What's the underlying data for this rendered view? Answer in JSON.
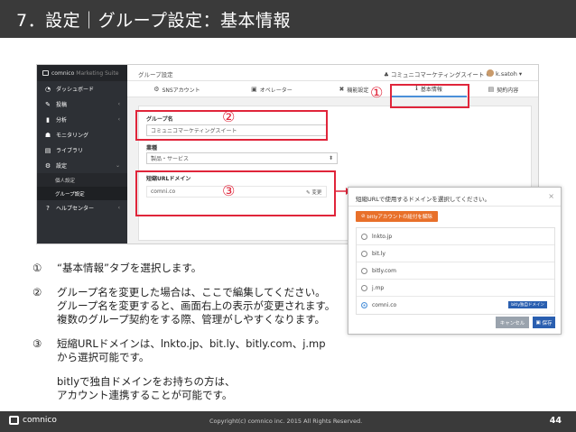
{
  "slide": {
    "title": "7．設定｜グループ設定：基本情報",
    "page_number": "44",
    "copyright": "Copyright(c) comnico inc. 2015 All Rights Reserved.",
    "footer_logo": "comnico"
  },
  "app": {
    "brand": "comnico",
    "brand_suite": "Marketing Suite",
    "nav": [
      {
        "icon": "dashboard-icon",
        "glyph": "◔",
        "label": "ダッシュボード"
      },
      {
        "icon": "pencil-icon",
        "glyph": "✎",
        "label": "投稿",
        "chevron": "‹"
      },
      {
        "icon": "chart-icon",
        "glyph": "▮",
        "label": "分析",
        "chevron": "‹"
      },
      {
        "icon": "chat-icon",
        "glyph": "☗",
        "label": "モニタリング"
      },
      {
        "icon": "book-icon",
        "glyph": "▤",
        "label": "ライブラリ"
      },
      {
        "icon": "gear-icon",
        "glyph": "⚙",
        "label": "設定",
        "chevron": "⌄"
      }
    ],
    "nav_sub": [
      "個人設定",
      "グループ設定"
    ],
    "nav_help": {
      "icon": "question-icon",
      "glyph": "?",
      "label": "ヘルプセンター",
      "chevron": "‹"
    },
    "page_title": "グループ設定",
    "group_selector": "コミュニコマーケティングスイート",
    "user_name": "k.satoh",
    "tabs": [
      {
        "icon": "sns-icon",
        "glyph": "⚙",
        "label": "SNSアカウント"
      },
      {
        "icon": "person-card-icon",
        "glyph": "▣",
        "label": "オペレーター"
      },
      {
        "icon": "wrench-icon",
        "glyph": "✖",
        "label": "機能設定"
      },
      {
        "icon": "info-icon",
        "glyph": "ℹ",
        "label": "基本情報"
      },
      {
        "icon": "contract-icon",
        "glyph": "▤",
        "label": "契約内容"
      }
    ],
    "fields": {
      "group_name_label": "グループ名",
      "group_name_value": "コミュニコマーケティングスイート",
      "industry_label": "業種",
      "industry_value": "製品・サービス",
      "domain_label": "短縮URLドメイン",
      "domain_value": "comni.co",
      "edit_label": "✎ 変更"
    }
  },
  "popup": {
    "header": "短縮URLで使用するドメインを選択してください。",
    "close": "×",
    "bitly_button": "bitlyアカウントの紐付を解除",
    "options": [
      {
        "label": "lnkto.jp",
        "selected": false
      },
      {
        "label": "bit.ly",
        "selected": false
      },
      {
        "label": "bitly.com",
        "selected": false
      },
      {
        "label": "j.mp",
        "selected": false
      },
      {
        "label": "comni.co",
        "selected": true,
        "badge": "bitly独自ドメイン"
      }
    ],
    "cancel": "キャンセル",
    "save": "保存"
  },
  "markers": [
    "①",
    "②",
    "③"
  ],
  "explanation": {
    "item1_mark": "①",
    "item1_text": "“基本情報”タブを選択します。",
    "item2_mark": "②",
    "item2_line1": "グループ名を変更した場合は、ここで編集してください。",
    "item2_line2": "グループ名を変更すると、画面右上の表示が変更されます。",
    "item2_line3": "複数のグループ契約をする際、管理がしやすくなります。",
    "item3_mark": "③",
    "item3_line1": "短縮URLドメインは、lnkto.jp、bit.ly、bitly.com、j.mp",
    "item3_line2": "から選択可能です。",
    "item3_line4": "bitlyで独自ドメインをお持ちの方は、",
    "item3_line5": "アカウント連携することが可能です。"
  }
}
